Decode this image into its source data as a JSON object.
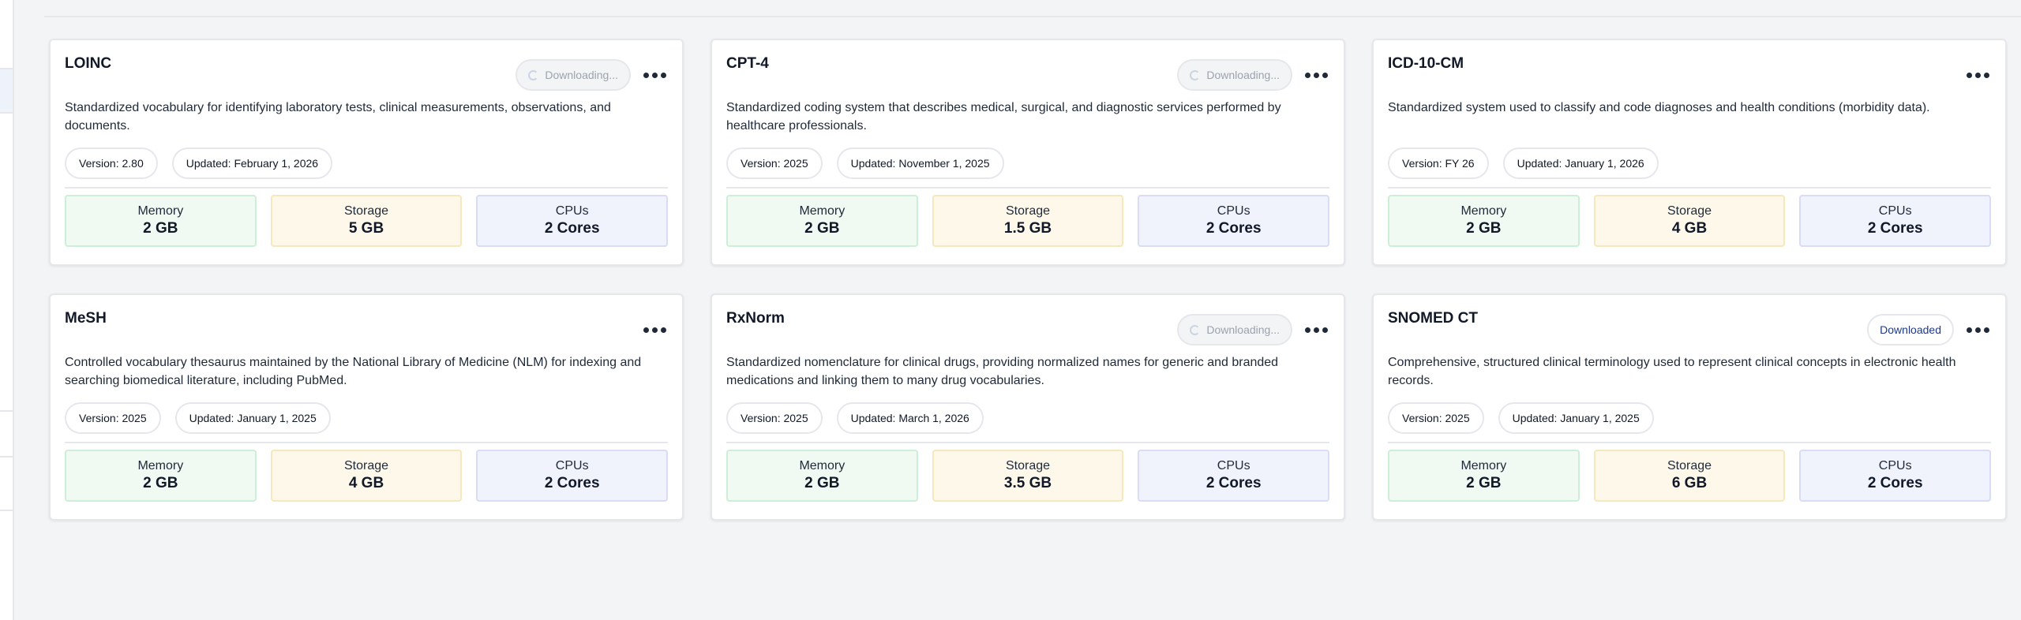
{
  "labels": {
    "memory": "Memory",
    "storage": "Storage",
    "cpus": "CPUs"
  },
  "cards": [
    {
      "name": "LOINC",
      "status": "Downloading...",
      "description": "Standardized vocabulary for identifying laboratory tests, clinical measurements, observations, and documents.",
      "version": "Version: 2.80",
      "updated": "Updated: February 1, 2026",
      "memory": "2 GB",
      "storage": "5 GB",
      "cpus": "2 Cores"
    },
    {
      "name": "CPT-4",
      "status": "Downloading...",
      "description": "Standardized coding system that describes medical, surgical, and diagnostic services performed by healthcare professionals.",
      "version": "Version: 2025",
      "updated": "Updated: November 1, 2025",
      "memory": "2 GB",
      "storage": "1.5 GB",
      "cpus": "2 Cores"
    },
    {
      "name": "ICD-10-CM",
      "status": "",
      "description": "Standardized system used to classify and code diagnoses and health conditions (morbidity data).",
      "version": "Version: FY 26",
      "updated": "Updated: January 1, 2026",
      "memory": "2 GB",
      "storage": "4 GB",
      "cpus": "2 Cores"
    },
    {
      "name": "MeSH",
      "status": "",
      "description": "Controlled vocabulary thesaurus maintained by the National Library of Medicine (NLM) for indexing and searching biomedical literature, including PubMed.",
      "version": "Version: 2025",
      "updated": "Updated: January 1, 2025",
      "memory": "2 GB",
      "storage": "4 GB",
      "cpus": "2 Cores"
    },
    {
      "name": "RxNorm",
      "status": "Downloading...",
      "description": "Standardized nomenclature for clinical drugs, providing normalized names for generic and branded medications and linking them to many drug vocabularies.",
      "version": "Version: 2025",
      "updated": "Updated: March 1, 2026",
      "memory": "2 GB",
      "storage": "3.5 GB",
      "cpus": "2 Cores"
    },
    {
      "name": "SNOMED CT",
      "status": "Downloaded",
      "description": "Comprehensive, structured clinical terminology used to represent clinical concepts in electronic health records.",
      "version": "Version: 2025",
      "updated": "Updated: January 1, 2025",
      "memory": "2 GB",
      "storage": "6 GB",
      "cpus": "2 Cores"
    }
  ],
  "icons": {
    "spinner": "spinner-icon",
    "more": "more-options-icon"
  },
  "colors": {
    "memory_bg": "#f0faf3",
    "storage_bg": "#fdf8ea",
    "cpus_bg": "#f1f3fc",
    "downloaded_text": "#1e3a8a",
    "downloading_text": "#9ca3af"
  }
}
